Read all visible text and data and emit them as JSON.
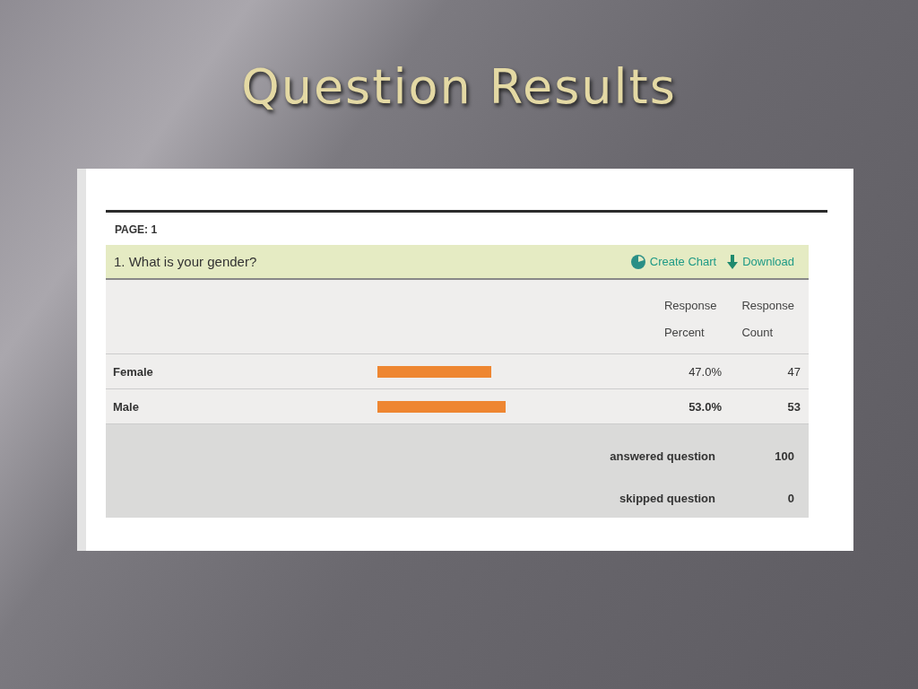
{
  "slide": {
    "title": "Question Results"
  },
  "page_label": "PAGE: 1",
  "question": {
    "text": "1. What is your gender?",
    "actions": [
      {
        "kind": "chart",
        "label": "Create Chart"
      },
      {
        "kind": "download",
        "label": "Download"
      }
    ]
  },
  "columns": [
    {
      "line1": "Response",
      "line2": "Percent"
    },
    {
      "line1": "Response",
      "line2": "Count"
    }
  ],
  "rows": [
    {
      "label": "Female",
      "level": 0.47,
      "percent": "47.0%",
      "count": "47",
      "highlighted": false
    },
    {
      "label": "Male",
      "level": 0.53,
      "percent": "53.0%",
      "count": "53",
      "highlighted": true
    }
  ],
  "summary": [
    {
      "label": "answered question",
      "value": "100"
    },
    {
      "label": "skipped question",
      "value": "0"
    }
  ]
}
